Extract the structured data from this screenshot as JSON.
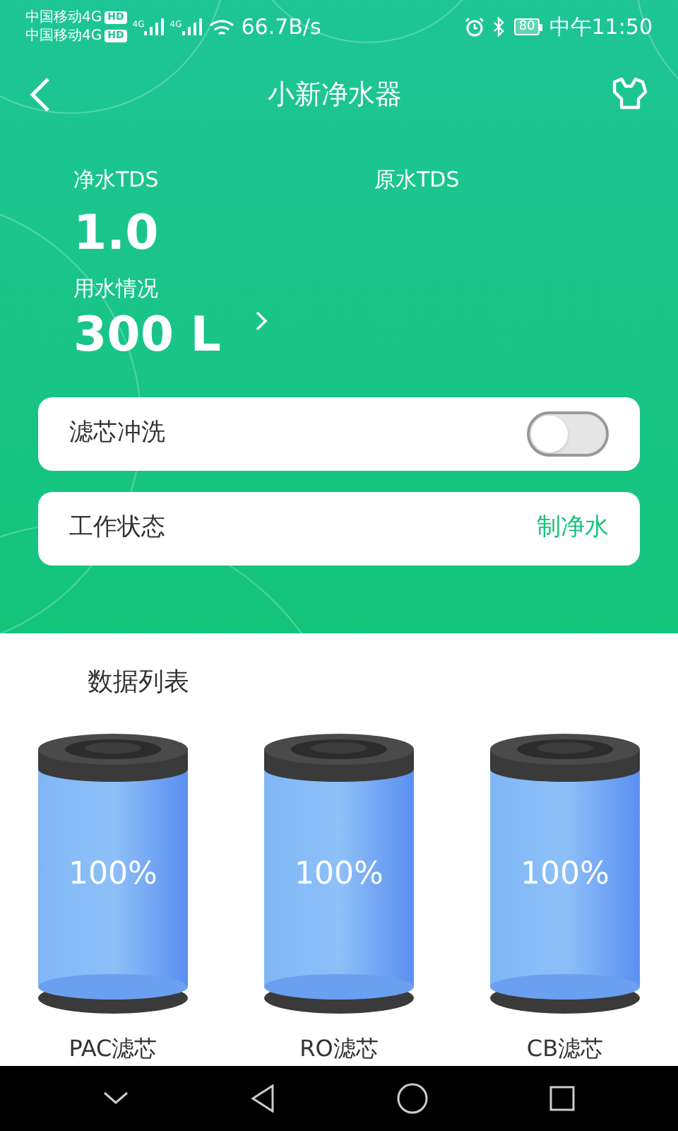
{
  "status_bar": {
    "carriers": [
      {
        "name": "中国移动4G",
        "badge": "HD"
      },
      {
        "name": "中国移动4G",
        "badge": "HD"
      }
    ],
    "networks": [
      "4G",
      "4G"
    ],
    "speed": "66.7B/s",
    "battery": "80",
    "time": "中午11:50"
  },
  "header": {
    "title": "小新净水器"
  },
  "stats": [
    {
      "label": "净水TDS",
      "value": "1.0"
    },
    {
      "label": "原水TDS"
    }
  ],
  "usage": {
    "label": "用水情况",
    "value": "300 L"
  },
  "flush": {
    "label": "滤芯冲洗",
    "on": false
  },
  "work_status": {
    "label": "工作状态",
    "value": "制净水"
  },
  "section_title": "数据列表",
  "filters": [
    {
      "name": "PAC滤芯",
      "reading": "100%"
    },
    {
      "name": "RO滤芯",
      "reading": "100%"
    },
    {
      "name": "CB滤芯",
      "reading": "100%"
    }
  ]
}
